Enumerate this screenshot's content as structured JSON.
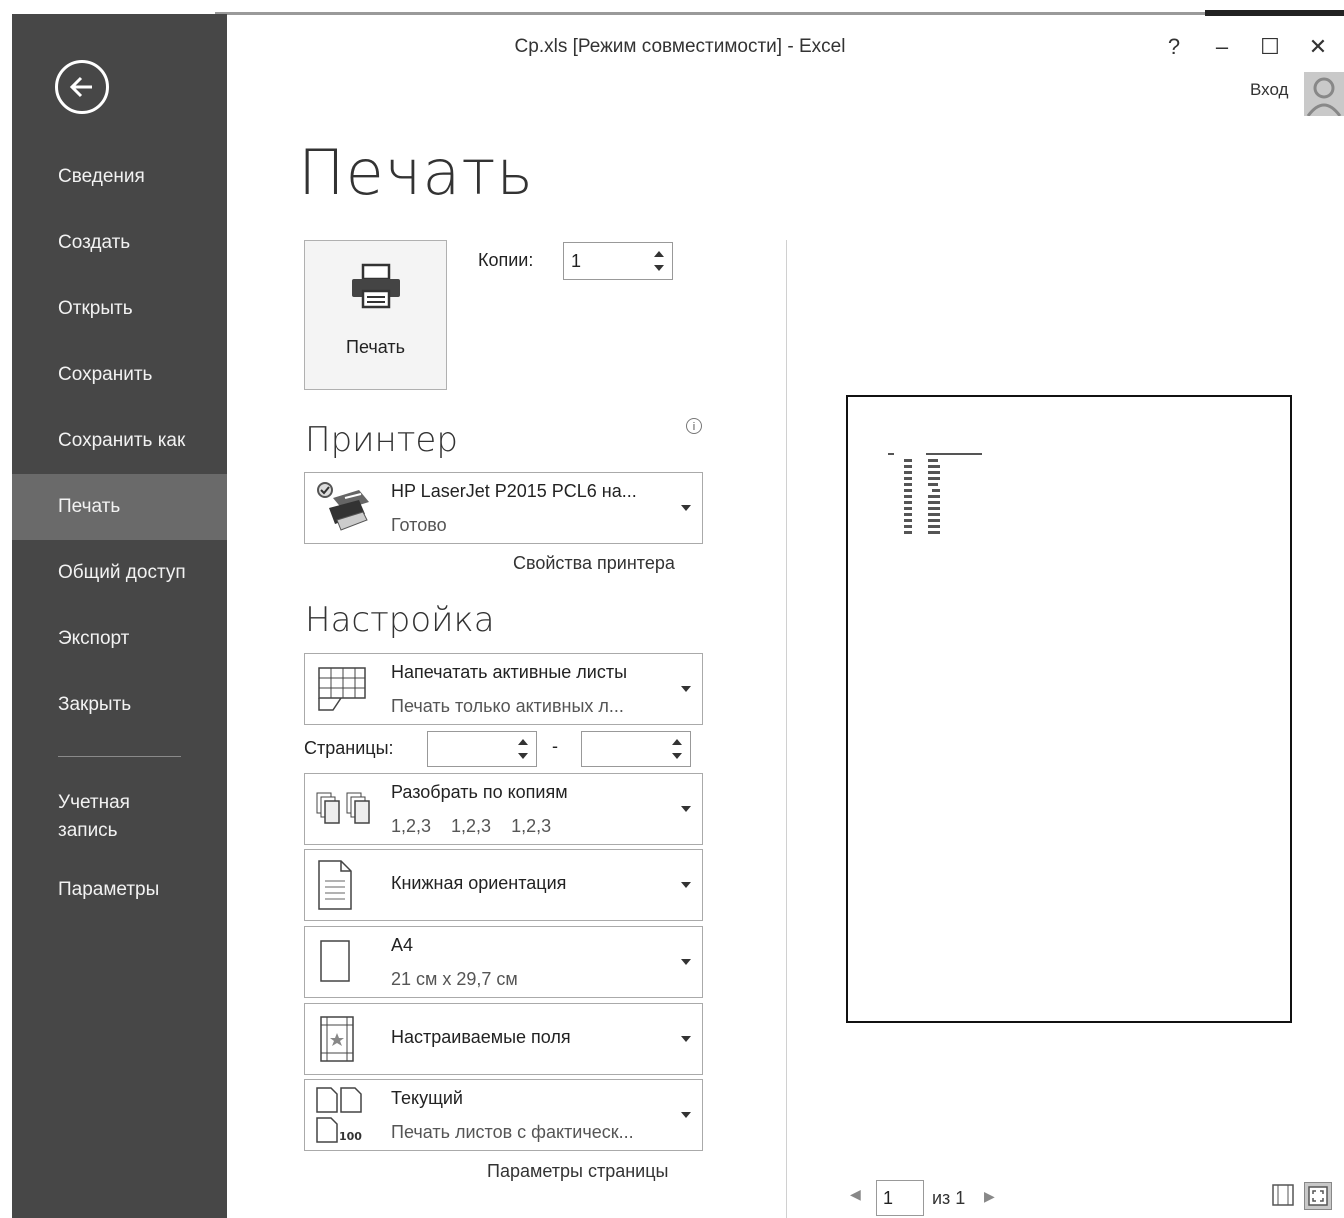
{
  "window": {
    "title": "Ср.xls  [Режим совместимости] - Excel",
    "help": "?",
    "minimize": "–",
    "maximize": "☐",
    "close": "✕",
    "signin": "Вход"
  },
  "sidebar": {
    "items": [
      {
        "label": "Сведения"
      },
      {
        "label": "Создать"
      },
      {
        "label": "Открыть"
      },
      {
        "label": "Сохранить"
      },
      {
        "label": "Сохранить как"
      },
      {
        "label": "Печать",
        "active": true
      },
      {
        "label": "Общий доступ"
      },
      {
        "label": "Экспорт"
      },
      {
        "label": "Закрыть"
      }
    ],
    "bottom_items": [
      {
        "label": "Учетная запись"
      },
      {
        "label": "Параметры"
      }
    ]
  },
  "print": {
    "heading": "Печать",
    "button_label": "Печать",
    "copies_label": "Копии:",
    "copies_value": "1"
  },
  "printer": {
    "heading": "Принтер",
    "info": "i",
    "name": "HP LaserJet P2015 PCL6 на...",
    "status": "Готово",
    "properties_link": "Свойства принтера"
  },
  "settings": {
    "heading": "Настройка",
    "what": {
      "title": "Напечатать активные листы",
      "subtitle": "Печать только активных л..."
    },
    "pages_label": "Страницы:",
    "pages_from": "",
    "pages_dash": "-",
    "pages_to": "",
    "collate": {
      "title": "Разобрать по копиям",
      "subtitle": "1,2,3    1,2,3    1,2,3"
    },
    "orientation": {
      "title": "Книжная ориентация"
    },
    "paper": {
      "title": "A4",
      "subtitle": "21 см x 29,7 см"
    },
    "margins": {
      "title": "Настраиваемые поля"
    },
    "scaling": {
      "title": "Текущий",
      "subtitle": "Печать листов с фактическ...",
      "icon_text": "100"
    },
    "page_setup_link": "Параметры страницы"
  },
  "preview": {
    "current_page": "1",
    "of_pages": "из 1"
  }
}
